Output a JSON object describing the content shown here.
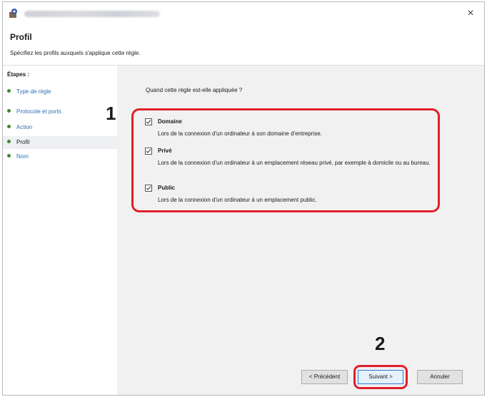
{
  "header": {
    "title": "Profil",
    "subtitle": "Spécifiez les profils auxquels s'applique cette règle."
  },
  "titlebar": {
    "close_label": "×"
  },
  "sidebar": {
    "label": "Étapes :",
    "steps": [
      {
        "label": "Type de règle",
        "current": false
      },
      {
        "label": "Protocole et ports",
        "current": false
      },
      {
        "label": "Action",
        "current": false
      },
      {
        "label": "Profil",
        "current": true
      },
      {
        "label": "Nom",
        "current": false
      }
    ]
  },
  "content": {
    "question": "Quand cette règle est-elle appliquée ?",
    "options": [
      {
        "label": "Domaine",
        "checked": true,
        "description": "Lors de la connexion d'un ordinateur à son domaine d'entreprise."
      },
      {
        "label": "Privé",
        "checked": true,
        "description": "Lors de la connexion d'un ordinateur à un emplacement réseau privé, par exemple à domicile ou au bureau."
      },
      {
        "label": "Public",
        "checked": true,
        "description": "Lors de la connexion d'un ordinateur à un emplacement public."
      }
    ]
  },
  "buttons": {
    "previous": "< Précédent",
    "next": "Suivant >",
    "cancel": "Annuler"
  },
  "annotations": {
    "step1": "1",
    "step2": "2"
  },
  "colors": {
    "highlight": "#e0202a",
    "link": "#2e6fb7",
    "step_dot": "#3a8a2c"
  }
}
